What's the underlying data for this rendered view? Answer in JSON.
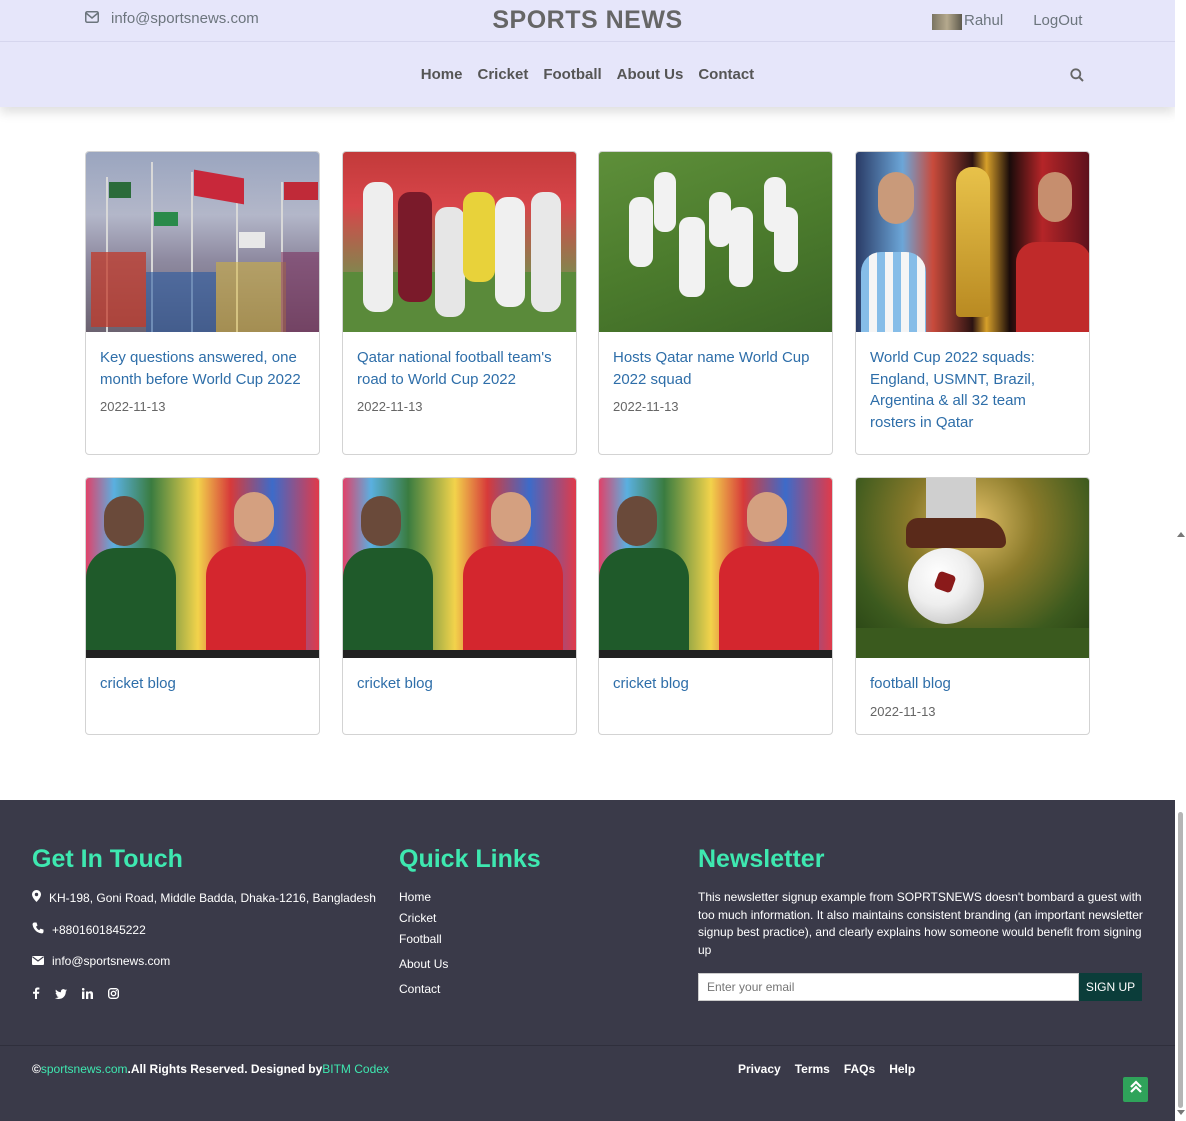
{
  "header": {
    "email": "info@sportsnews.com",
    "brand": "SPORTS NEWS",
    "user_name": "Rahul",
    "logout": "LogOut",
    "nav": [
      "Home",
      "Cricket",
      "Football",
      "About Us",
      "Contact"
    ]
  },
  "cards": [
    {
      "title": "Key questions answered, one month before World Cup 2022",
      "date": "2022-11-13"
    },
    {
      "title": "Qatar national football team's road to World Cup 2022",
      "date": "2022-11-13"
    },
    {
      "title": "Hosts Qatar name World Cup 2022 squad",
      "date": "2022-11-13"
    },
    {
      "title": "World Cup 2022 squads: England, USMNT, Brazil, Argentina & all 32 team rosters in Qatar",
      "date": ""
    },
    {
      "title": "cricket blog",
      "date": ""
    },
    {
      "title": "cricket blog",
      "date": ""
    },
    {
      "title": "cricket blog",
      "date": ""
    },
    {
      "title": "football blog",
      "date": "2022-11-13"
    }
  ],
  "footer": {
    "contact_heading": "Get In Touch",
    "address": "KH-198, Goni Road, Middle Badda, Dhaka-1216, Bangladesh",
    "phone": "+8801601845222",
    "email": "info@sportsnews.com",
    "links_heading": "Quick Links",
    "links": [
      "Home",
      "Cricket",
      "Football",
      "About Us",
      "Contact"
    ],
    "newsletter_heading": "Newsletter",
    "newsletter_text": "This newsletter signup example from SOPRTSNEWS doesn't bombard a guest with too much information. It also maintains consistent branding (an important newsletter signup best practice), and clearly explains how someone would benefit from signing up",
    "email_placeholder": "Enter your email",
    "signup_label": "SIGN UP",
    "copyright_symbol": "©",
    "copyright_site": "sportsnews.com",
    "copyright_text": ".All Rights Reserved. Designed by",
    "designer": "BITM Codex",
    "bottom_links": [
      "Privacy",
      "Terms",
      "FAQs",
      "Help"
    ]
  },
  "colors": {
    "header_bg": "#e6e6fa",
    "link_blue": "#2e6ea9",
    "footer_bg": "#3a3a49",
    "footer_accent": "#3ee8b0",
    "signup_bg": "#0b3d3a",
    "to_top_bg": "#2fa35a"
  }
}
